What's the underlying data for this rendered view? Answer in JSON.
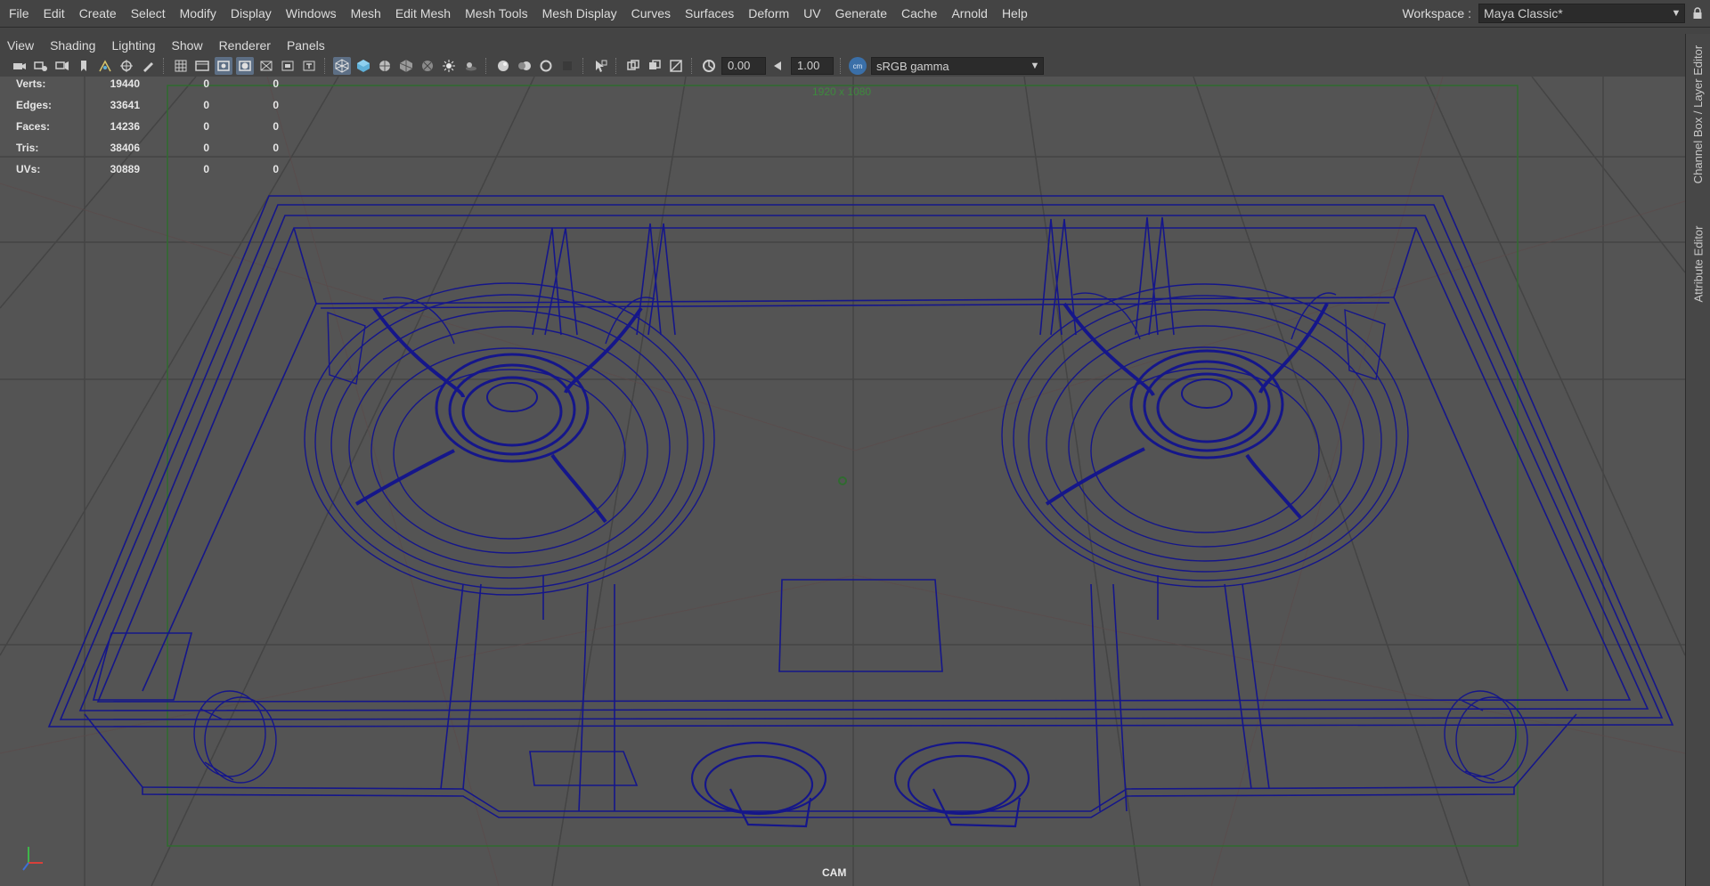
{
  "menubar": {
    "items": [
      "File",
      "Edit",
      "Create",
      "Select",
      "Modify",
      "Display",
      "Windows",
      "Mesh",
      "Edit Mesh",
      "Mesh Tools",
      "Mesh Display",
      "Curves",
      "Surfaces",
      "Deform",
      "UV",
      "Generate",
      "Cache",
      "Arnold",
      "Help"
    ],
    "workspace_label": "Workspace :",
    "workspace_value": "Maya Classic*",
    "lock_icon": "lock-icon"
  },
  "panel_menu": {
    "items": [
      "View",
      "Shading",
      "Lighting",
      "Show",
      "Renderer",
      "Panels"
    ]
  },
  "toolbar": {
    "exposure": "0.00",
    "gamma": "1.00",
    "colorspace_icon_text": "cm",
    "colorspace": "sRGB gamma"
  },
  "hud": {
    "rows": [
      {
        "label": "Verts:",
        "v1": "19440",
        "v2": "0",
        "v3": "0"
      },
      {
        "label": "Edges:",
        "v1": "33641",
        "v2": "0",
        "v3": "0"
      },
      {
        "label": "Faces:",
        "v1": "14236",
        "v2": "0",
        "v3": "0"
      },
      {
        "label": "Tris:",
        "v1": "38406",
        "v2": "0",
        "v3": "0"
      },
      {
        "label": "UVs:",
        "v1": "30889",
        "v2": "0",
        "v3": "0"
      }
    ],
    "resolution": "1920 x 1080",
    "camera": "CAM"
  },
  "side_tabs": {
    "channel_box": "Channel Box / Layer Editor",
    "attribute_editor": "Attribute Editor"
  },
  "colors": {
    "wireframe": "#15168a",
    "grid": "#3b3b3b",
    "resolution_gate": "#2f6b2f",
    "viewport_bg": "#545454"
  }
}
